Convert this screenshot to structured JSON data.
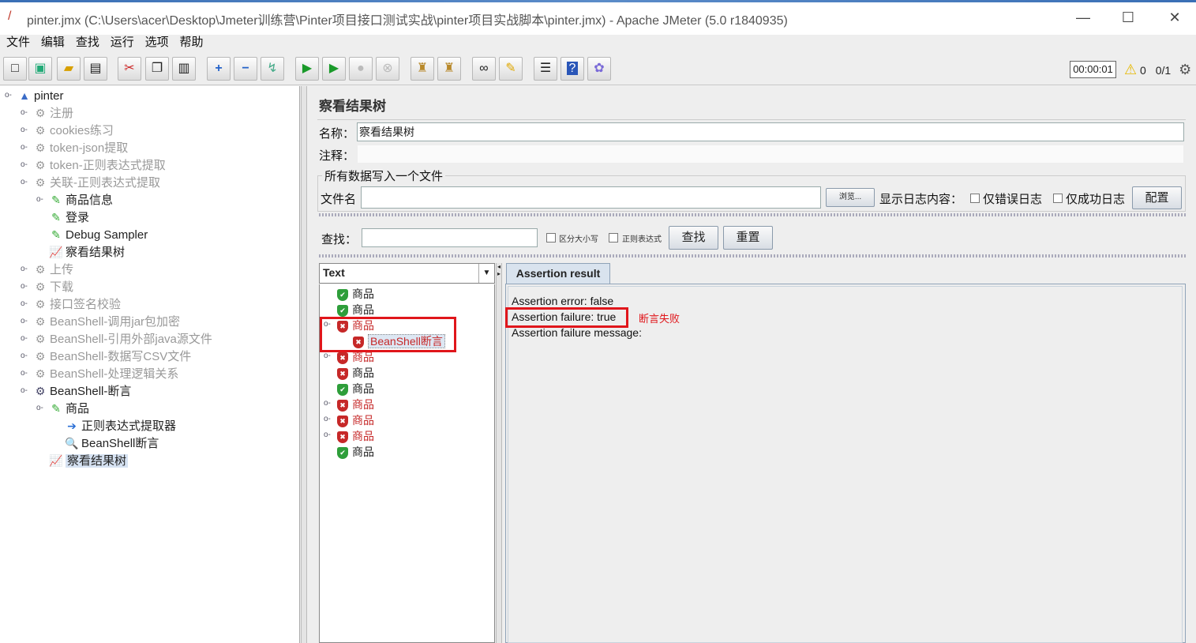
{
  "window": {
    "title": "pinter.jmx (C:\\Users\\acer\\Desktop\\Jmeter训练营\\Pinter项目接口测试实战\\pinter项目实战脚本\\pinter.jmx) - Apache JMeter (5.0 r1840935)",
    "minimize": "—",
    "maximize": "☐",
    "close": "✕"
  },
  "menu": [
    "文件",
    "编辑",
    "查找",
    "运行",
    "选项",
    "帮助"
  ],
  "toolbar": {
    "timer": "00:00:01",
    "warning_count": "0",
    "threads": "0/1"
  },
  "tree": {
    "root": "pinter",
    "items": [
      {
        "label": "注册"
      },
      {
        "label": "cookies练习"
      },
      {
        "label": "token-json提取"
      },
      {
        "label": "token-正则表达式提取"
      },
      {
        "label": "关联-正则表达式提取"
      },
      {
        "label": "商品信息"
      },
      {
        "label": "登录"
      },
      {
        "label": "Debug Sampler"
      },
      {
        "label": "察看结果树"
      },
      {
        "label": "上传"
      },
      {
        "label": "下载"
      },
      {
        "label": "接口签名校验"
      },
      {
        "label": "BeanShell-调用jar包加密"
      },
      {
        "label": "BeanShell-引用外部java源文件"
      },
      {
        "label": "BeanShell-数据写CSV文件"
      },
      {
        "label": "BeanShell-处理逻辑关系"
      },
      {
        "label": "BeanShell-断言"
      },
      {
        "label": "商品"
      },
      {
        "label": "正则表达式提取器"
      },
      {
        "label": "BeanShell断言"
      },
      {
        "label": "察看结果树"
      }
    ]
  },
  "panel": {
    "title": "察看结果树",
    "name_label": "名称：",
    "name_value": "察看结果树",
    "comment_label": "注释：",
    "file_group_title": "所有数据写入一个文件",
    "filename_label": "文件名",
    "browse_label": "浏览...",
    "log_label": "显示日志内容：",
    "errors_only": "仅错误日志",
    "success_only": "仅成功日志",
    "config_label": "配置",
    "search_label": "查找：",
    "case_sensitive": "区分大小写",
    "regex": "正则表达式",
    "search_button": "查找",
    "reset_button": "重置"
  },
  "results": {
    "renderer": "Text",
    "rows": [
      {
        "label": "商品",
        "status": "ok"
      },
      {
        "label": "商品",
        "status": "ok"
      },
      {
        "label": "商品",
        "status": "fail"
      },
      {
        "label": "BeanShell断言",
        "status": "fail"
      },
      {
        "label": "商品",
        "status": "fail"
      },
      {
        "label": "商品",
        "status": "fail"
      },
      {
        "label": "商品",
        "status": "ok"
      },
      {
        "label": "商品",
        "status": "fail"
      },
      {
        "label": "商品",
        "status": "fail"
      },
      {
        "label": "商品",
        "status": "fail"
      },
      {
        "label": "商品",
        "status": "ok"
      }
    ]
  },
  "assertion": {
    "tab": "Assertion result",
    "error": "Assertion error: false",
    "failure": "Assertion failure: true",
    "message": "Assertion failure message:",
    "annotation": "断言失败"
  },
  "colors": {
    "fail": "#c62828",
    "ok": "#2e9e3a",
    "annotation": "#e0161b"
  }
}
